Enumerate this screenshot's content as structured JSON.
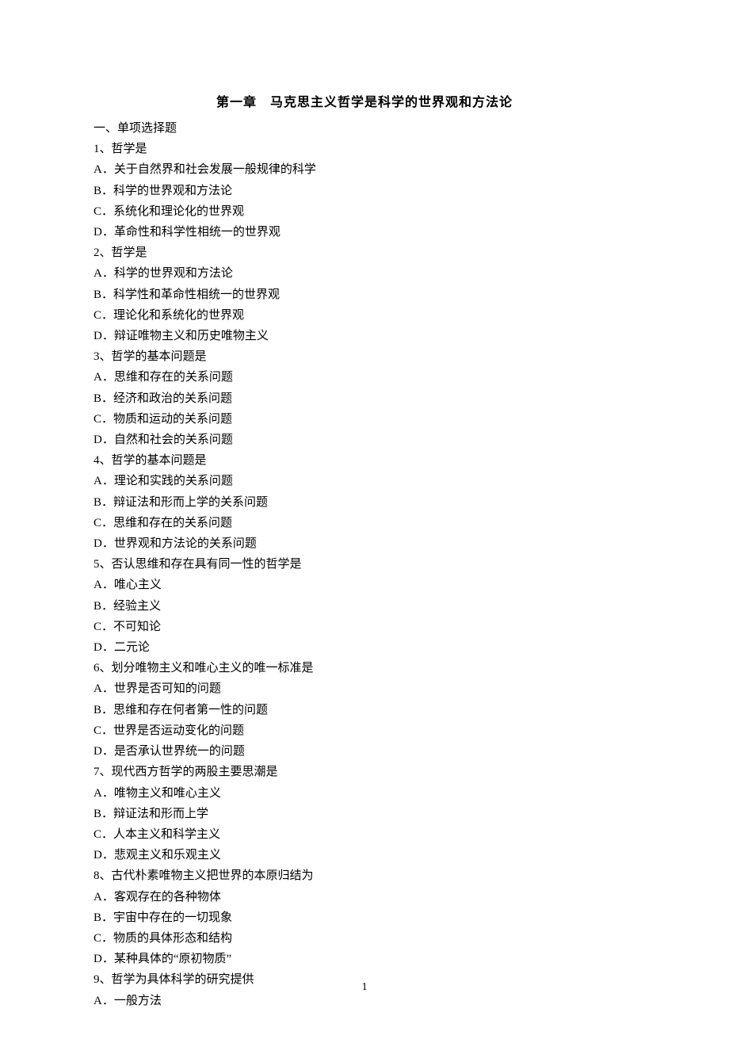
{
  "chapter_title": "第一章　马克思主义哲学是科学的世界观和方法论",
  "section_heading": "一、单项选择题",
  "questions": [
    {
      "stem": "1、哲学是",
      "options": [
        "A．关于自然界和社会发展一般规律的科学",
        "B．科学的世界观和方法论",
        "C．系统化和理论化的世界观",
        "D．革命性和科学性相统一的世界观"
      ]
    },
    {
      "stem": "2、哲学是",
      "options": [
        "A．科学的世界观和方法论",
        "B．科学性和革命性相统一的世界观",
        "C．理论化和系统化的世界观",
        "D．辩证唯物主义和历史唯物主义"
      ]
    },
    {
      "stem": "3、哲学的基本问题是",
      "options": [
        "A．思维和存在的关系问题",
        "B．经济和政治的关系问题",
        "C．物质和运动的关系问题",
        "D．自然和社会的关系问题"
      ]
    },
    {
      "stem": "4、哲学的基本问题是",
      "options": [
        "A．理论和实践的关系问题",
        "B．辩证法和形而上学的关系问题",
        "C．思维和存在的关系问题",
        "D．世界观和方法论的关系问题"
      ]
    },
    {
      "stem": "5、否认思维和存在具有同一性的哲学是",
      "options": [
        "A．唯心主义",
        "B．经验主义",
        "C．不可知论",
        "D．二元论"
      ]
    },
    {
      "stem": "6、划分唯物主义和唯心主义的唯一标准是",
      "options": [
        "A．世界是否可知的问题",
        "B．思维和存在何者第一性的问题",
        "C．世界是否运动变化的问题",
        "D．是否承认世界统一的问题"
      ]
    },
    {
      "stem": "7、现代西方哲学的两股主要思潮是",
      "options": [
        "A．唯物主义和唯心主义",
        "B．辩证法和形而上学",
        "C．人本主义和科学主义",
        "D．悲观主义和乐观主义"
      ]
    },
    {
      "stem": "8、古代朴素唯物主义把世界的本原归结为",
      "options": [
        "A．客观存在的各种物体",
        "B．宇宙中存在的一切现象",
        "C．物质的具体形态和结构",
        "D．某种具体的“原初物质”"
      ]
    },
    {
      "stem": "9、哲学为具体科学的研究提供",
      "options": [
        "A．一般方法"
      ]
    }
  ],
  "page_number": "1"
}
